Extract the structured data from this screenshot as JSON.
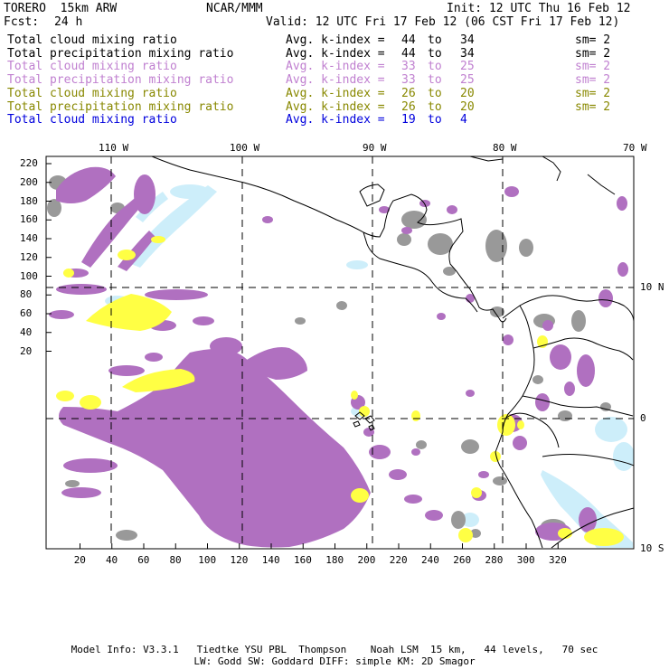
{
  "header": {
    "model": "TORERO  15km ARW",
    "org": "NCAR/MMM",
    "init": "Init: 12 UTC Thu 16 Feb 12",
    "fcst_label": "Fcst:",
    "fcst_value": "24 h",
    "valid": "Valid: 12 UTC Fri 17 Feb 12 (06 CST Fri 17 Feb 12)"
  },
  "legend": [
    {
      "field": "Total cloud mixing ratio",
      "avg": "Avg. k-index =",
      "from": "44",
      "to_word": "to",
      "to": "34",
      "sm": "sm= 2",
      "color": "#000000"
    },
    {
      "field": "Total precipitation mixing ratio",
      "avg": "Avg. k-index =",
      "from": "44",
      "to_word": "to",
      "to": "34",
      "sm": "sm= 2",
      "color": "#000000"
    },
    {
      "field": "Total cloud mixing ratio",
      "avg": "Avg. k-index =",
      "from": "33",
      "to_word": "to",
      "to": "25",
      "sm": "sm= 2",
      "color": "#c080d0"
    },
    {
      "field": "Total precipitation mixing ratio",
      "avg": "Avg. k-index =",
      "from": "33",
      "to_word": "to",
      "to": "25",
      "sm": "sm= 2",
      "color": "#c080d0"
    },
    {
      "field": "Total cloud mixing ratio",
      "avg": "Avg. k-index =",
      "from": "26",
      "to_word": "to",
      "to": "20",
      "sm": "sm= 2",
      "color": "#888800"
    },
    {
      "field": "Total precipitation mixing ratio",
      "avg": "Avg. k-index =",
      "from": "26",
      "to_word": "to",
      "to": "20",
      "sm": "sm= 2",
      "color": "#888800"
    },
    {
      "field": "Total cloud mixing ratio",
      "avg": "Avg. k-index =",
      "from": "19",
      "to_word": "to",
      "to": "4",
      "sm": "",
      "color": "#0000dd"
    }
  ],
  "axes": {
    "top_lon_labels": [
      "110 W",
      "100 W",
      "90 W",
      "80 W",
      "70 W"
    ],
    "right_lat_labels": [
      "10 N",
      "0",
      "10 S"
    ],
    "left_ticks": [
      "220",
      "200",
      "180",
      "160",
      "140",
      "120",
      "100",
      "80",
      "60",
      "40",
      "20"
    ],
    "bottom_ticks": [
      "20",
      "40",
      "60",
      "80",
      "100",
      "120",
      "140",
      "160",
      "180",
      "200",
      "220",
      "240",
      "260",
      "280",
      "300",
      "320"
    ]
  },
  "colors": {
    "gray": "#999999",
    "purple": "#b070c0",
    "yellow": "#ffff44",
    "lightblue": "#cdeefa",
    "grid": "#000000"
  },
  "footer": {
    "line1": "Model Info: V3.3.1   Tiedtke YSU PBL  Thompson    Noah LSM  15 km,   44 levels,   70 sec",
    "line2": "LW: Godd SW: Goddard DIFF: simple KM: 2D Smagor"
  }
}
